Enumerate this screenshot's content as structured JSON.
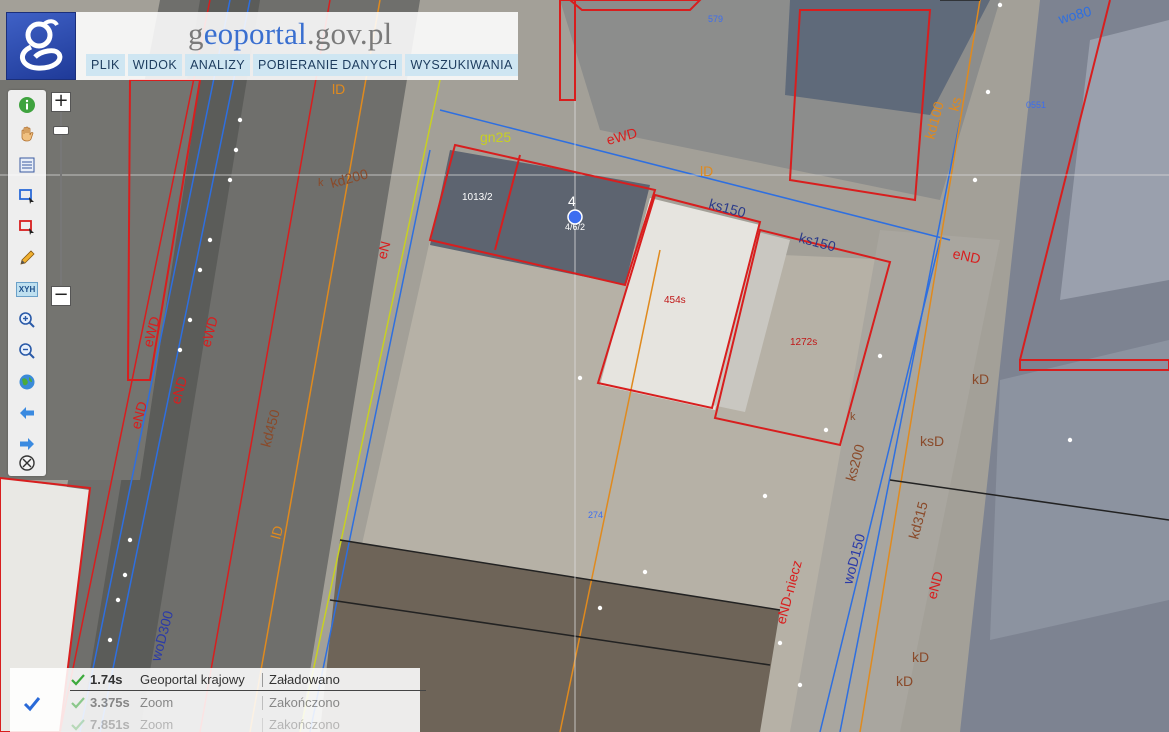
{
  "header": {
    "brand_pre": "g",
    "brand_highlight": "eoportal",
    "brand_post": ".gov.pl",
    "menu": [
      "PLIK",
      "WIDOK",
      "ANALIZY",
      "POBIERANIE DANYCH",
      "WYSZUKIWANIA"
    ]
  },
  "toolbar": {
    "icons": [
      "info-icon",
      "pan-hand-icon",
      "list-icon",
      "select-rectangle-icon",
      "select-red-icon",
      "pencil-icon",
      "xyh-icon",
      "zoom-in-icon",
      "zoom-out-icon",
      "globe-icon",
      "back-arrow-icon",
      "forward-arrow-icon",
      "clear-icon"
    ],
    "xyh_label": "XYH"
  },
  "zoom": {
    "plus": "+",
    "minus": "−"
  },
  "map": {
    "labels": {
      "ewd_top": "eWD",
      "ks150": "ks150",
      "ks150b": "ks150",
      "end_right": "eND",
      "kd100": "kd100",
      "ks": "ks",
      "wo80": "wo80",
      "kd200": "kd200",
      "en_left": "eN",
      "ewd_left": "eWD",
      "ewd_left2": "eWD",
      "end_left": "eND",
      "end_left2": "eND",
      "kd450": "kd450",
      "id_left": "lD",
      "id_mid": "lD",
      "id_right": "lD",
      "parcel_1013": "1013/2",
      "parcel_4": "4",
      "parcel_4sub": "4/6/2",
      "parcel_454": "454s",
      "parcel_1272": "1272s",
      "parcel_274": "274",
      "parcel_579": "579",
      "parcel_0551": "0551",
      "ks200": "ks200",
      "wod150": "woD150",
      "end_niecz": "eND-niecz",
      "wod300": "woD300",
      "kd315": "kd315",
      "ksd": "ksD",
      "kd_bottom": "kD",
      "kd_bottom2": "kD",
      "end_bottom": "eND",
      "en_niecz": "eND-niecz",
      "gn25": "gn25",
      "kd": "kD",
      "k1": "k",
      "k2": "k"
    }
  },
  "status": {
    "rows": [
      {
        "time": "1.74s",
        "source": "Geoportal krajowy",
        "state": "Załadowano"
      },
      {
        "time": "3.375s",
        "source": "Zoom",
        "state": "Zakończono"
      },
      {
        "time": "7.851s",
        "source": "Zoom",
        "state": "Zakończono"
      }
    ]
  },
  "colors": {
    "parcel_border": "#d81e1e",
    "utility_blue": "#2e6fe0",
    "utility_orange": "#e08a1e",
    "utility_yellow": "#c8d022",
    "menu_bg": "#cfe6f2",
    "logo_blue": "#2a48aa"
  }
}
